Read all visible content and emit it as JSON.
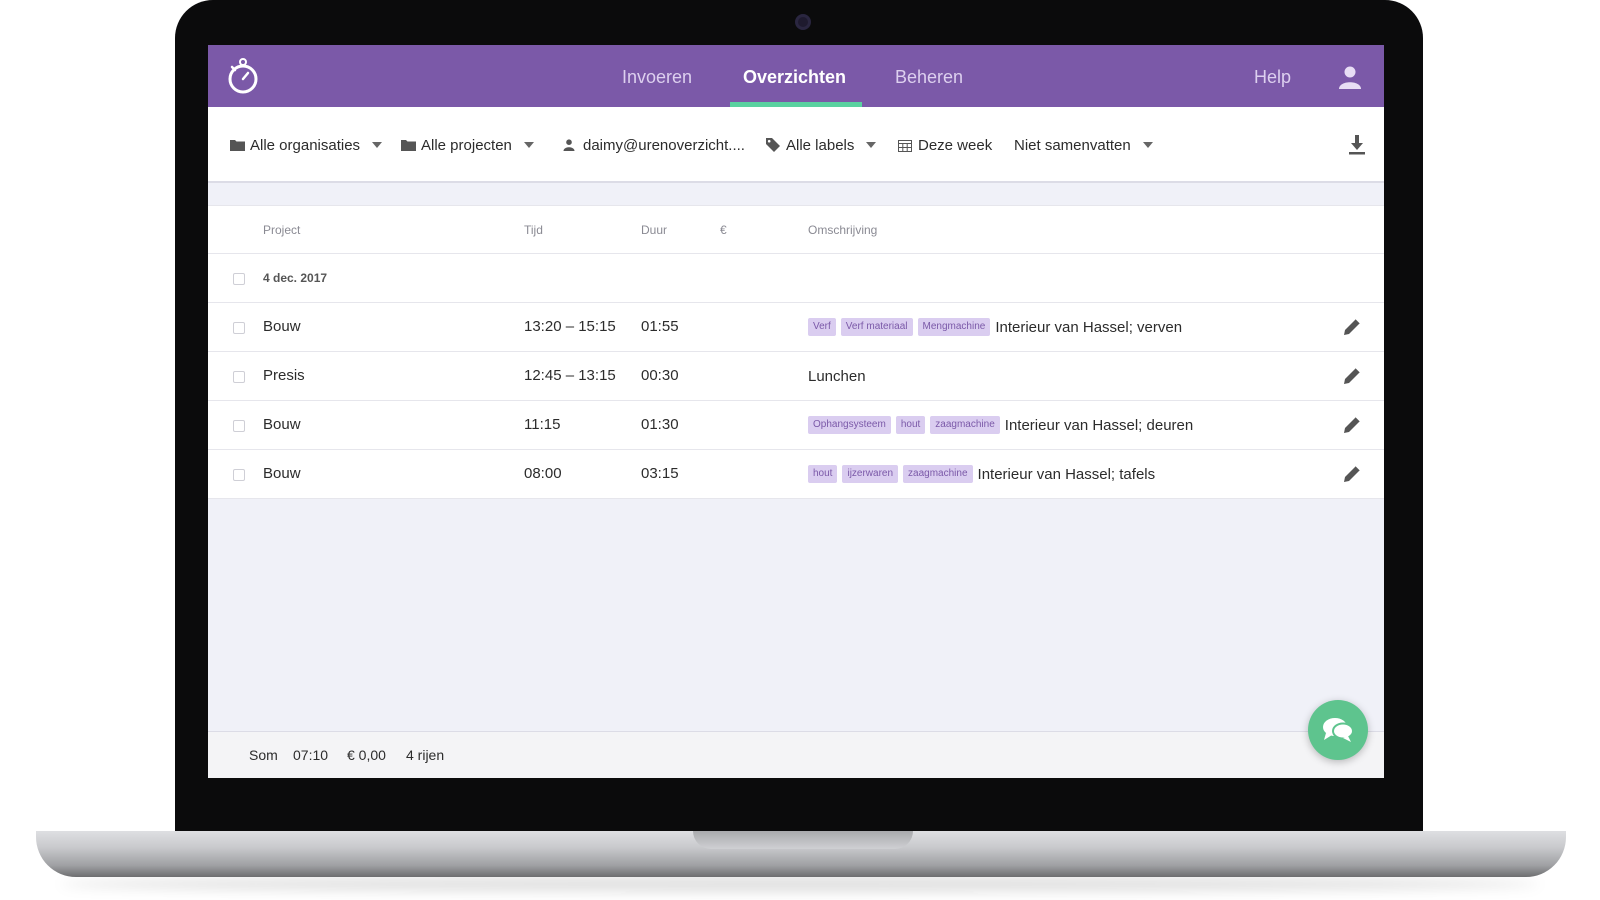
{
  "nav": {
    "tabs": [
      {
        "label": "Invoeren"
      },
      {
        "label": "Overzichten"
      },
      {
        "label": "Beheren"
      }
    ],
    "help_label": "Help"
  },
  "filters": {
    "organisations": "Alle organisaties",
    "projects": "Alle projecten",
    "user": "daimy@urenoverzicht....",
    "labels": "Alle labels",
    "period": "Deze week",
    "summarize": "Niet samenvatten"
  },
  "table": {
    "headers": {
      "project": "Project",
      "time": "Tijd",
      "duration": "Duur",
      "amount": "€",
      "description": "Omschrijving"
    },
    "date_group": "4 dec. 2017",
    "rows": [
      {
        "project": "Bouw",
        "time": "13:20 – 15:15",
        "duration": "01:55",
        "tags": [
          "Verf",
          "Verf materiaal",
          "Mengmachine"
        ],
        "description": "Interieur van Hassel; verven"
      },
      {
        "project": "Presis",
        "time": "12:45 – 13:15",
        "duration": "00:30",
        "tags": [],
        "description": "Lunchen"
      },
      {
        "project": "Bouw",
        "time": "11:15",
        "duration": "01:30",
        "tags": [
          "Ophangsysteem",
          "hout",
          "zaagmachine"
        ],
        "description": "Interieur van Hassel; deuren"
      },
      {
        "project": "Bouw",
        "time": "08:00",
        "duration": "03:15",
        "tags": [
          "hout",
          "ijzerwaren",
          "zaagmachine"
        ],
        "description": "Interieur van Hassel; tafels"
      }
    ]
  },
  "footer": {
    "sum_label": "Som",
    "total_time": "07:10",
    "total_amount": "€ 0,00",
    "row_count": "4 rijen"
  },
  "colors": {
    "brand_purple": "#7b59a8",
    "active_underline": "#5ad1a0",
    "tag_bg": "#dacdf0",
    "chat_green": "#5ec48e"
  },
  "icons": [
    "stopwatch-logo-icon",
    "user-icon",
    "folder-icon",
    "person-icon",
    "tag-icon",
    "calendar-icon",
    "download-icon",
    "pencil-icon",
    "chat-icon"
  ]
}
